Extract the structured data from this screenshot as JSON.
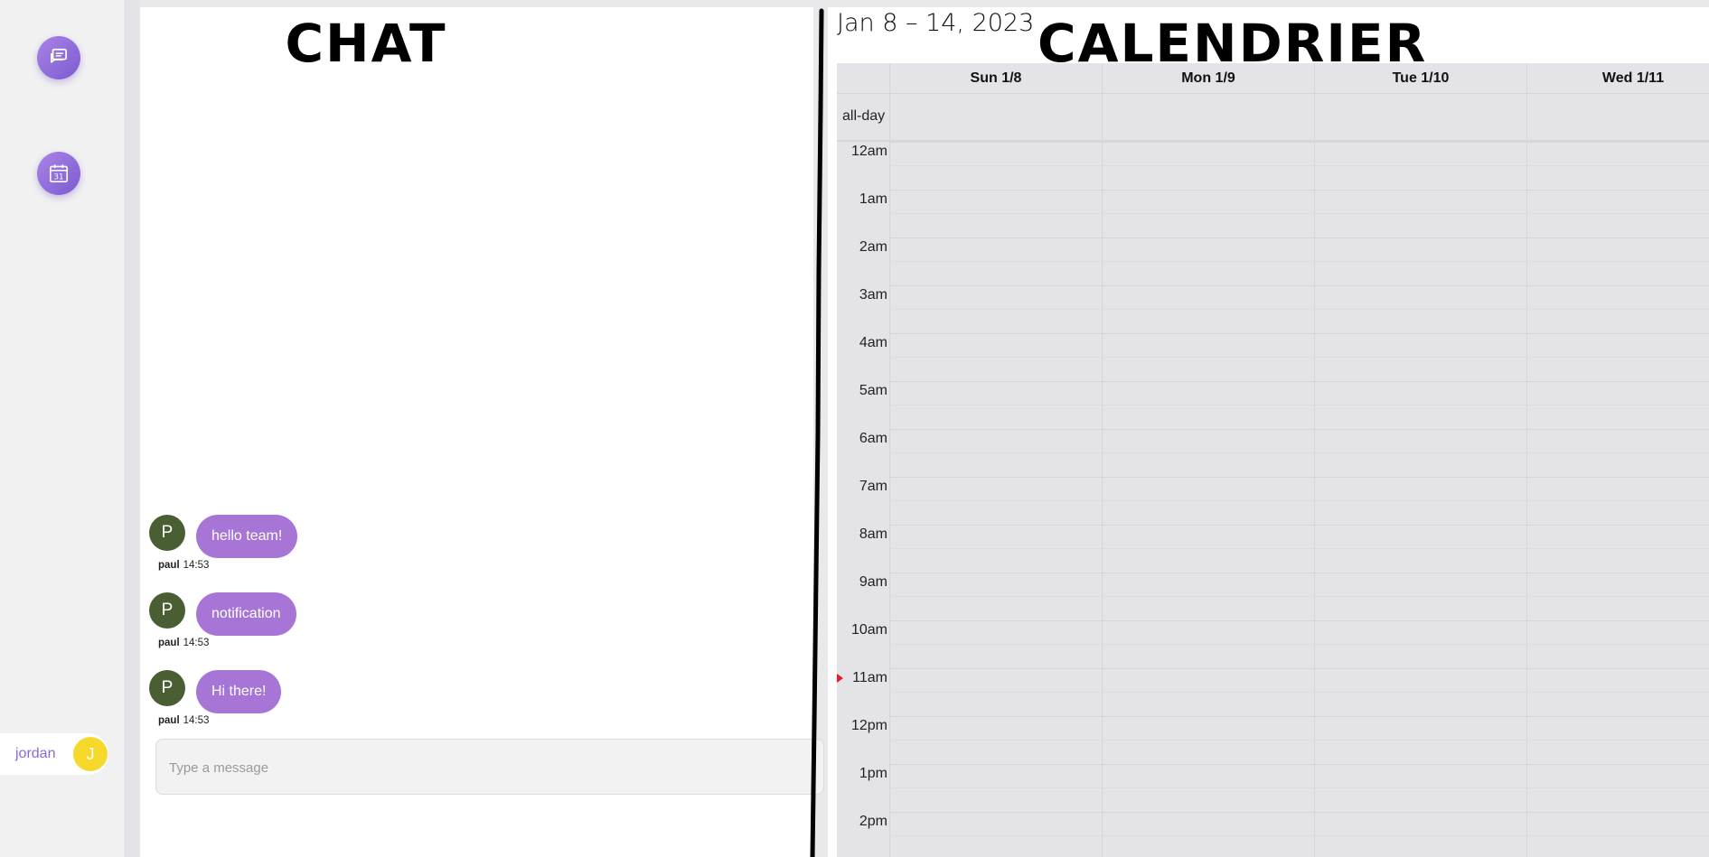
{
  "sidebar": {
    "nav": [
      {
        "label": "Chat",
        "icon": "chat-icon"
      },
      {
        "label": "Calendar",
        "icon": "calendar-icon",
        "icon_text": "31"
      }
    ],
    "user": {
      "name": "jordan",
      "initial": "J",
      "avatar_color": "#f6d82b"
    }
  },
  "chat": {
    "title": "CHAT",
    "messages": [
      {
        "author": "paul",
        "initial": "P",
        "text": "hello team!",
        "time": "14:53"
      },
      {
        "author": "paul",
        "initial": "P",
        "text": "notification",
        "time": "14:53"
      },
      {
        "author": "paul",
        "initial": "P",
        "text": "Hi there!",
        "time": "14:53"
      }
    ],
    "composer": {
      "placeholder": "Type a message",
      "value": ""
    },
    "colors": {
      "bubble": "#a675d6",
      "avatar": "#4a5e34"
    }
  },
  "calendar": {
    "title": "CALENDRIER",
    "range": "Jan 8 – 14, 2023",
    "days": [
      "Sun 1/8",
      "Mon 1/9",
      "Tue 1/10",
      "Wed 1/11"
    ],
    "allday_label": "all-day",
    "hours": [
      "12am",
      "1am",
      "2am",
      "3am",
      "4am",
      "5am",
      "6am",
      "7am",
      "8am",
      "9am",
      "10am",
      "11am",
      "12pm",
      "1pm",
      "2pm"
    ],
    "now_indicator_color": "#e0202b"
  }
}
